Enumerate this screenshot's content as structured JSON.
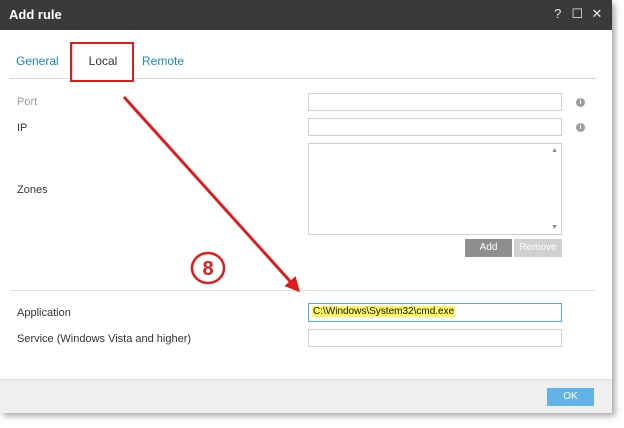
{
  "window": {
    "title": "Add rule",
    "help": "?",
    "maximize": "☐",
    "close": "✕"
  },
  "tabs": {
    "general": "General",
    "local": "Local",
    "remote": "Remote"
  },
  "form": {
    "port_label": "Port",
    "ip_label": "IP",
    "zones_label": "Zones",
    "application_label": "Application",
    "application_value": "C:\\Windows\\System32\\cmd.exe",
    "service_label": "Service (Windows Vista and higher)",
    "info_glyph": "i"
  },
  "buttons": {
    "add": "Add",
    "remove": "Remove",
    "ok": "OK"
  },
  "annotation": {
    "step_number": "8",
    "color": "#e01b1b"
  },
  "colors": {
    "titlebar": "#3a3a3a",
    "tab_link": "#1a87c7",
    "ok_button": "#62b4e6",
    "highlight": "#fff85a"
  }
}
